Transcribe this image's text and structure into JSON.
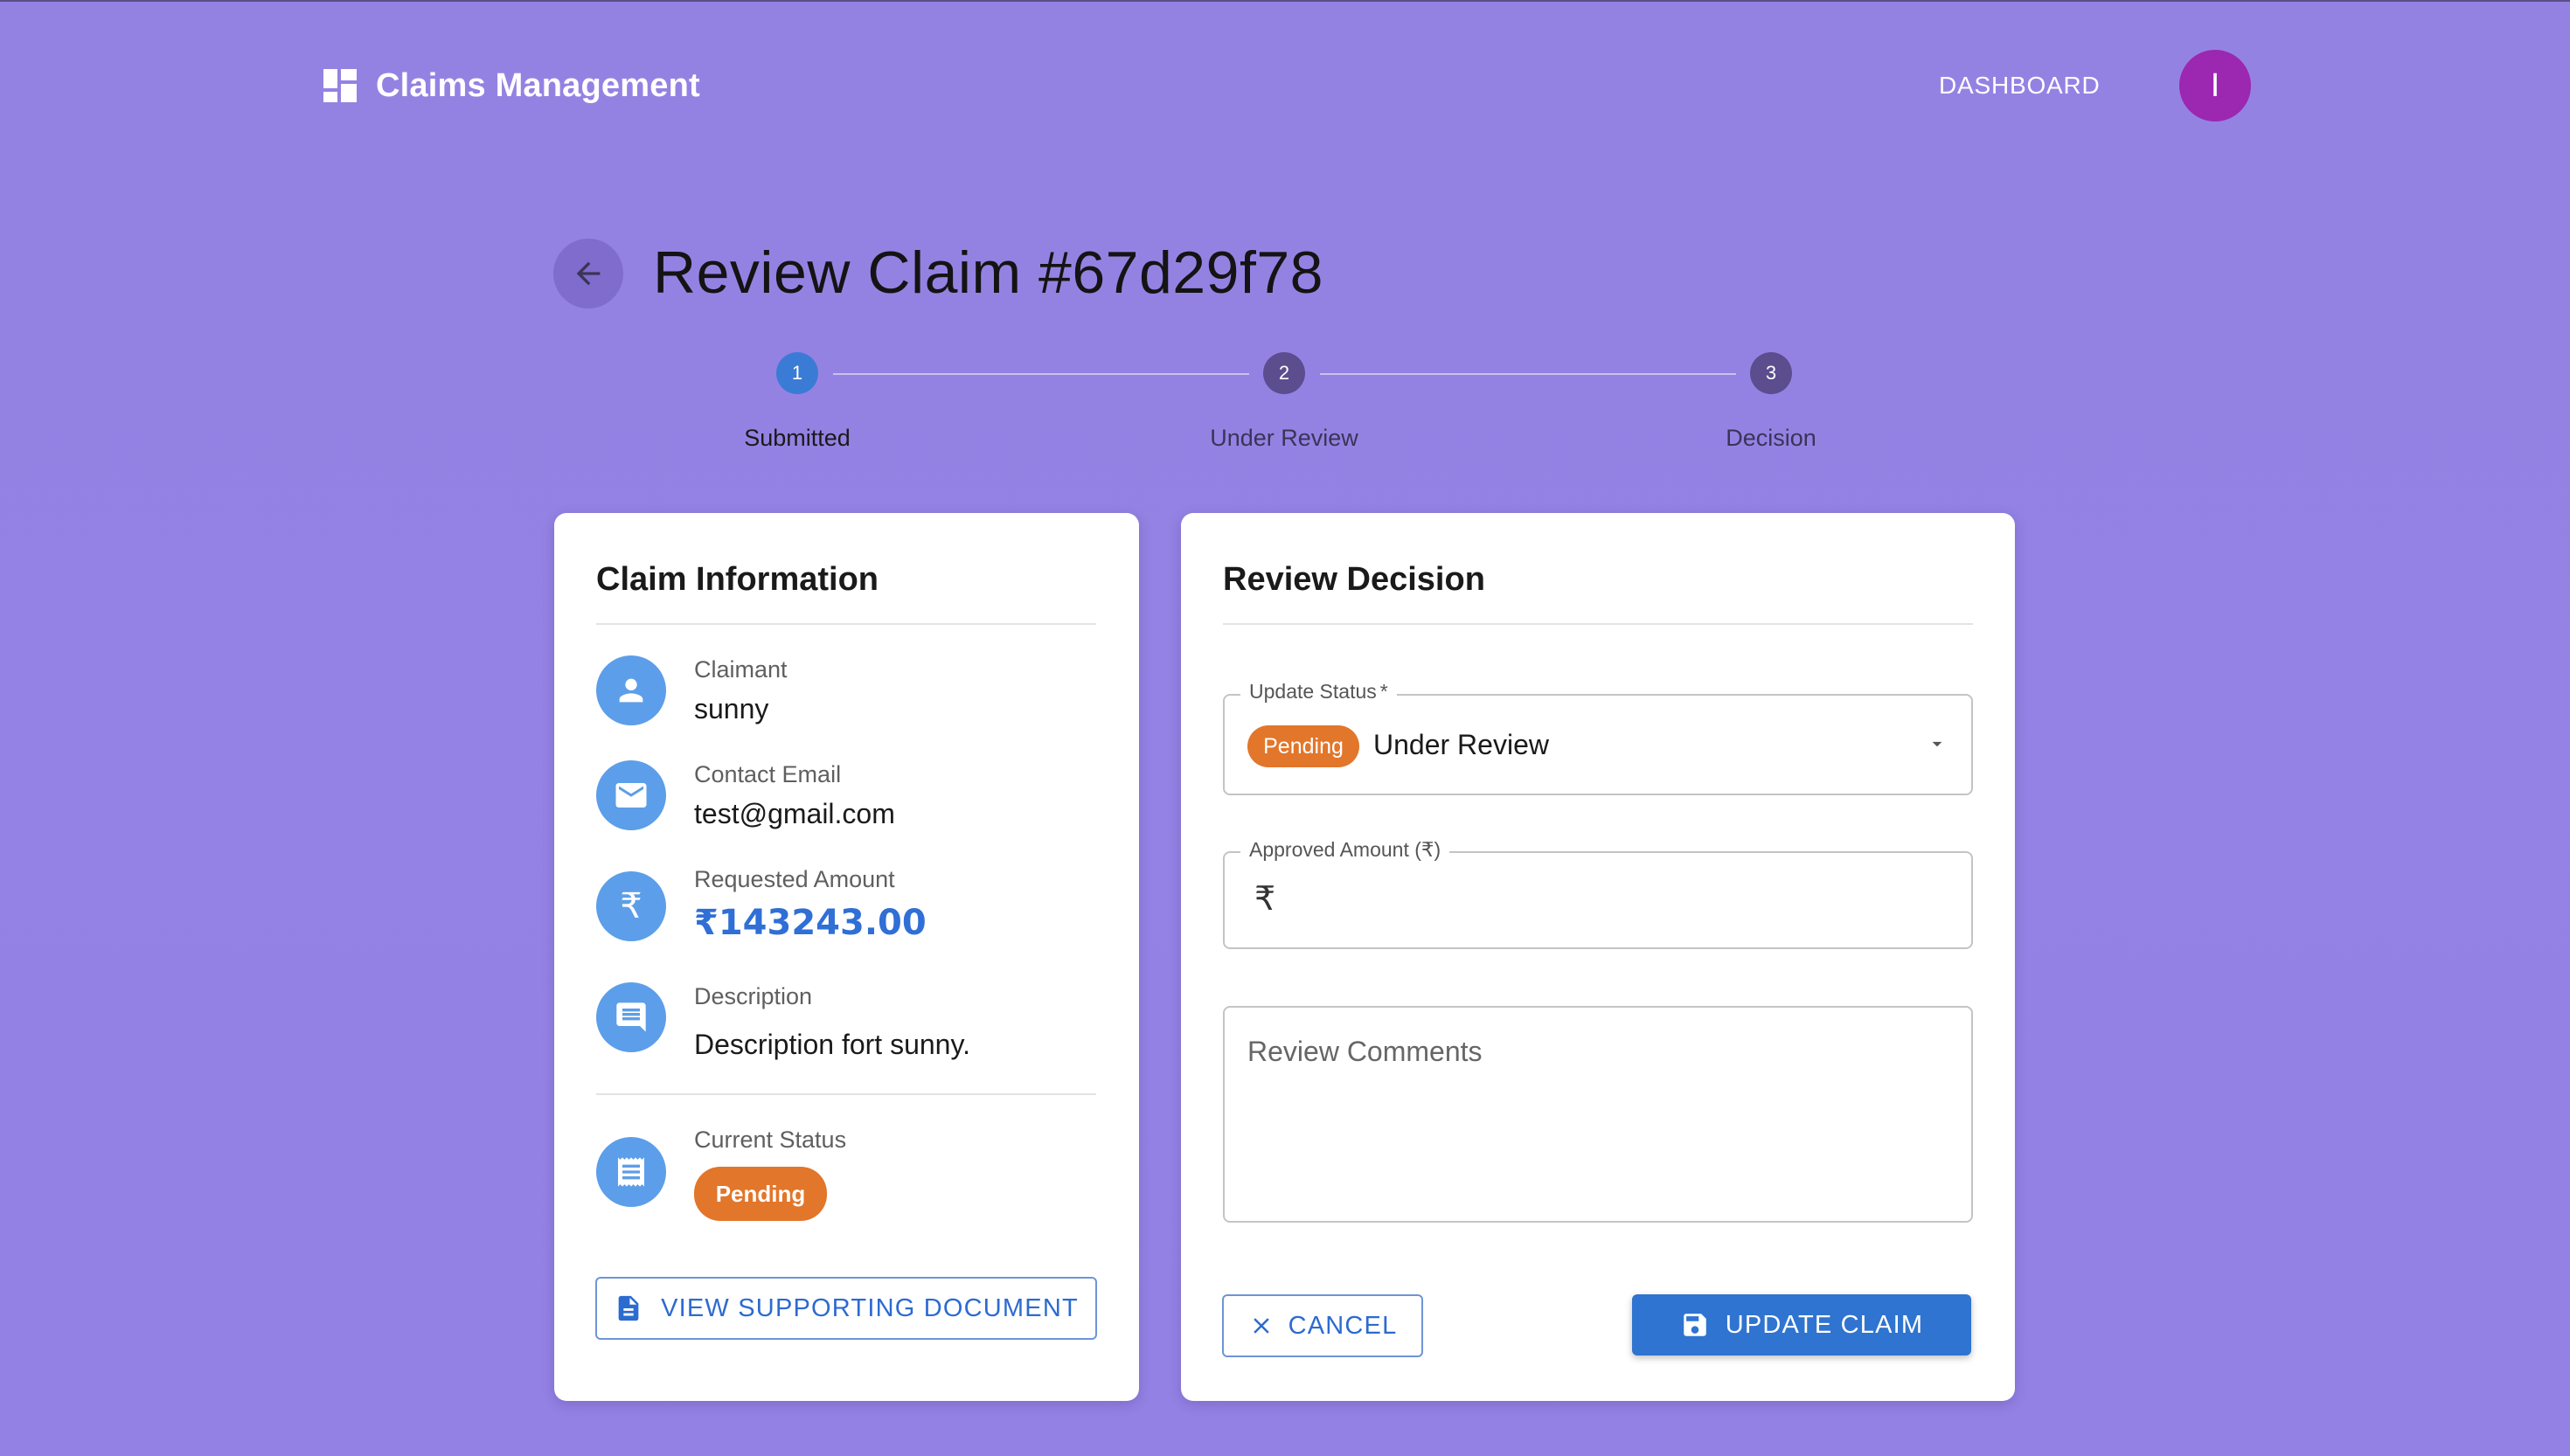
{
  "app": {
    "title": "Claims Management",
    "nav_dashboard": "DASHBOARD",
    "avatar_initial": "I"
  },
  "page": {
    "title": "Review Claim #67d29f78"
  },
  "stepper": {
    "steps": [
      {
        "number": "1",
        "label": "Submitted",
        "active": true
      },
      {
        "number": "2",
        "label": "Under Review",
        "active": false
      },
      {
        "number": "3",
        "label": "Decision",
        "active": false
      }
    ]
  },
  "claim_info": {
    "title": "Claim Information",
    "claimant_label": "Claimant",
    "claimant_value": "sunny",
    "email_label": "Contact Email",
    "email_value": "test@gmail.com",
    "amount_label": "Requested Amount",
    "amount_value": "₹143243.00",
    "description_label": "Description",
    "description_value": "Description fort sunny.",
    "status_label": "Current Status",
    "status_value": "Pending",
    "view_doc_button": "VIEW SUPPORTING DOCUMENT"
  },
  "review": {
    "title": "Review Decision",
    "status_field_label": "Update Status",
    "required_mark": "*",
    "status_badge": "Pending",
    "status_selected": "Under Review",
    "amount_field_label": "Approved Amount (₹)",
    "currency_symbol": "₹",
    "amount_value": "",
    "comments_placeholder": "Review Comments",
    "cancel_button": "CANCEL",
    "update_button": "UPDATE CLAIM"
  },
  "colors": {
    "background": "#9482e3",
    "primary": "#2f74d0",
    "pending": "#e2762a",
    "avatar": "#9c27b0",
    "step_active": "#3a7bd5",
    "step_inactive": "#5b4d8e"
  }
}
